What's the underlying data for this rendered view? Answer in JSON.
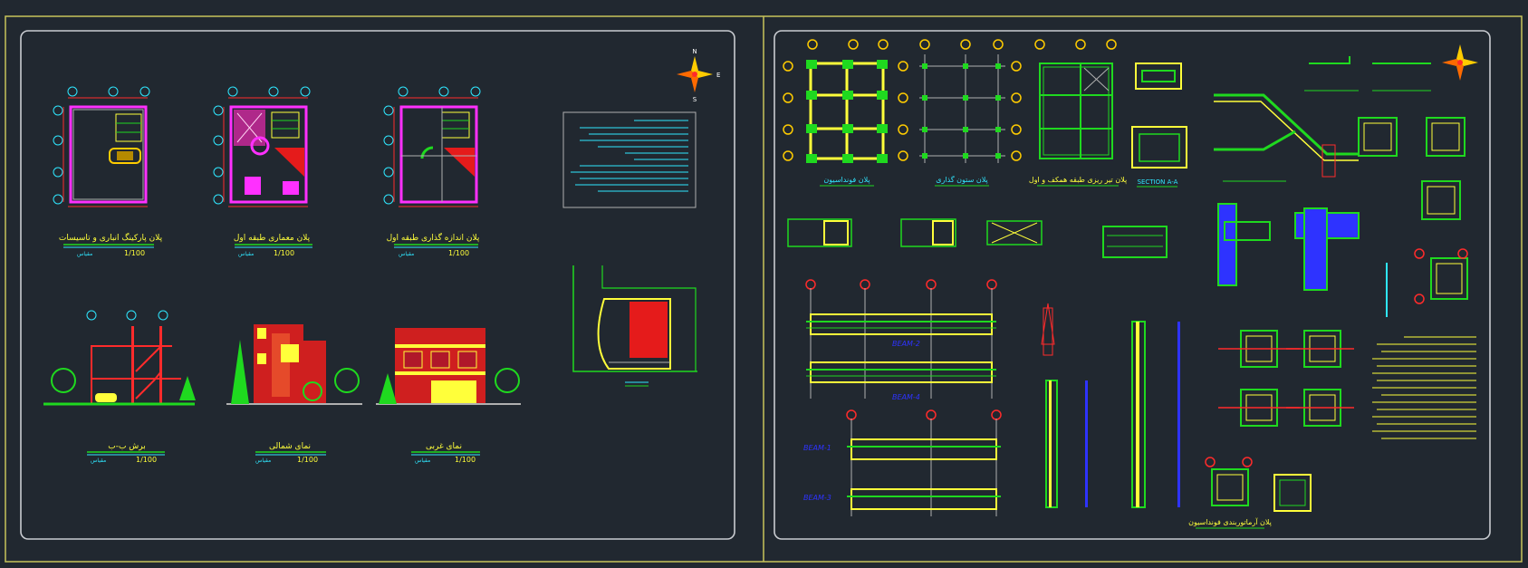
{
  "sheet_left": {
    "plan_titles": [
      "پلان پارکینگ انباری و تاسیسات",
      "پلان معماری طبقه اول",
      "پلان اندازه گذاری طبقه اول"
    ],
    "elevation_titles": [
      "برش ب-ب",
      "نمای شمالی",
      "نمای غربی"
    ],
    "scale_word": "مقیاس",
    "scale_value": "1/100"
  },
  "sheet_right": {
    "section_label": "SECTION A-A",
    "beam_labels": [
      "BEAM-2",
      "BEAM-4",
      "BEAM-1",
      "BEAM-3"
    ],
    "plan_titles": [
      "پلان فونداسیون",
      "پلان ستون گذاری",
      "پلان تیر ریزی طبقه همکف و اول"
    ],
    "bottom_title": "پلان آرماتوربندی فونداسیون"
  },
  "colors": {
    "background": "#212830",
    "frame": "#c8c45a",
    "panel_border": "#c9ccd1",
    "cad_red": "#ff2b2b",
    "cad_yellow": "#ffff3a",
    "cad_green": "#1fd91f",
    "cad_cyan": "#2fe7ff",
    "cad_magenta": "#ff30ff",
    "cad_blue": "#2e33ff"
  },
  "icons": [
    "compass-north-icon"
  ]
}
